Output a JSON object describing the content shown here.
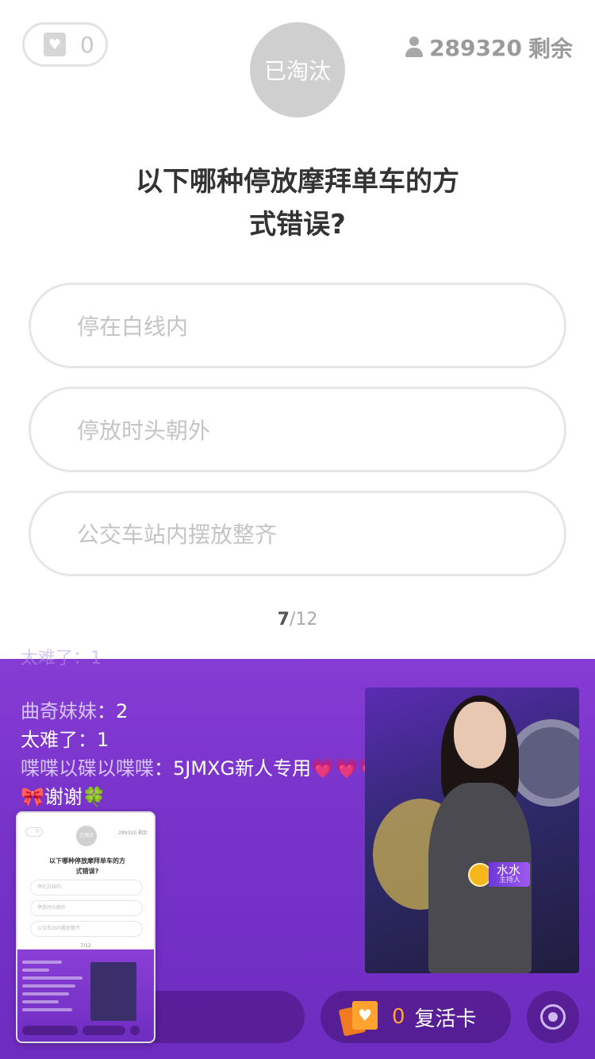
{
  "header": {
    "heart_count": "0",
    "status_label": "已淘汰",
    "remaining_count": "289320",
    "remaining_suffix": "剩余"
  },
  "question": {
    "text": "以下哪种停放摩拜单车的方式错误?",
    "line1": "以下哪种停放摩拜单车的方",
    "line2": "式错误?"
  },
  "options": [
    {
      "label": "停在白线内"
    },
    {
      "label": "停放时头朝外"
    },
    {
      "label": "公交车站内摆放整齐"
    }
  ],
  "progress": {
    "current": "7",
    "total": "/12"
  },
  "chat": [
    {
      "name": "太难了",
      "message": "1",
      "faded": true
    },
    {
      "name": "曲奇妹妹",
      "message": "2"
    },
    {
      "name": "太难了",
      "message": "1"
    },
    {
      "name": "喋喋以碟以喋喋",
      "message": "5JMXG新人专用💗💗💗"
    },
    {
      "name": "",
      "message": "🎀谢谢🍀"
    }
  ],
  "host": {
    "name": "水水",
    "role": "主持人"
  },
  "bottom": {
    "revive_count": "0",
    "revive_label": "复活卡"
  },
  "thumbnail": {
    "status_label": "已淘汰",
    "remaining": "289320 剩余",
    "progress": "7/12"
  },
  "colors": {
    "purple_top": "#8a3fd6",
    "purple_bottom": "#6e2cc0",
    "orange": "#ffa33a",
    "gray_text": "#c4c4c4"
  },
  "icons": {
    "heart_badge": "heart-icon",
    "person": "person-icon",
    "revive": "revive-card-icon",
    "target": "target-icon"
  }
}
